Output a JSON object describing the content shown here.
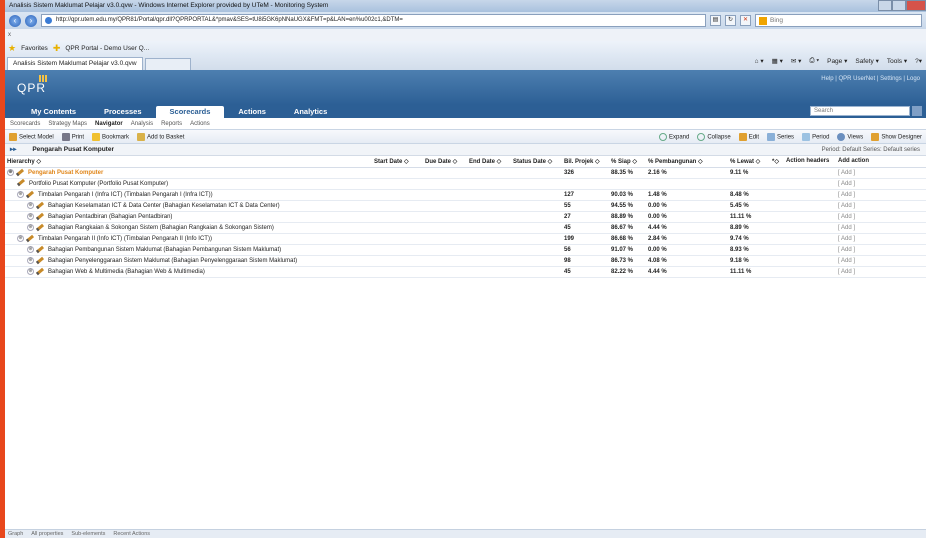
{
  "browser": {
    "title": "Analisis Sistem Maklumat Pelajar v3.0.qvw - Windows Internet Explorer provided by UTeM - Monitoring System",
    "url": "http://qpr.utem.edu.my/QPR81/Portal/qpr.dll?QPRPORTAL&*pmav&SES=tU8i5GK6pNNaUGX&FMT=p&LAN=en%u002c1,&DTM=",
    "search_placeholder": "Bing",
    "row2_text": "x",
    "favorites_label": "Favorites",
    "fav_link": "QPR Portal - Demo User Q...",
    "tab_title": "Analisis Sistem Maklumat Pelajar v3.0.qvw",
    "commands": [
      "Page ▾",
      "Safety ▾",
      "Tools ▾"
    ]
  },
  "app": {
    "logo": "QPR",
    "header_links": "Help | QPR UserNet | Settings | Logo",
    "nav_tabs": [
      "My Contents",
      "Processes",
      "Scorecards",
      "Actions",
      "Analytics"
    ],
    "active_tab": "Scorecards",
    "search_placeholder": "Search",
    "subnav": [
      "Scorecards",
      "Strategy Maps",
      "Navigator",
      "Analysis",
      "Reports",
      "Actions"
    ],
    "active_subnav": "Navigator",
    "toolbar_left": [
      "Select Model",
      "Print",
      "Bookmark",
      "Add to Basket"
    ],
    "toolbar_right": [
      "Expand",
      "Collapse",
      "Edit",
      "Series",
      "Period",
      "Views",
      "Show Designer"
    ],
    "breadcrumb": "Pengarah Pusat Komputer",
    "period_text": "Period: Default  Series: Default series"
  },
  "table": {
    "headers": [
      "Hierarchy ◇",
      "Start Date ◇",
      "Due Date ◇",
      "End Date ◇",
      "Status Date ◇",
      "Bil. Projek ◇",
      "% Siap ◇",
      "% Pembangunan ◇",
      "% Lewat ◇",
      "*◇",
      "Action headers",
      "Add action"
    ],
    "rows": [
      {
        "name": "Pengarah Pusat Komputer",
        "bil": "326",
        "siap": "88.35 %",
        "pemb": "2.16 %",
        "lewat": "9.11 %",
        "add": "[ Add ]"
      },
      {
        "name": "Portfolio Pusat Komputer (Portfolio Pusat Komputer)",
        "bil": "",
        "siap": "",
        "pemb": "",
        "lewat": "",
        "add": "[ Add ]"
      },
      {
        "name": "Timbalan Pengarah I (Infra ICT) (Timbalan Pengarah I (Infra ICT))",
        "bil": "127",
        "siap": "90.03 %",
        "pemb": "1.48 %",
        "lewat": "8.48 %",
        "add": "[ Add ]"
      },
      {
        "name": "Bahagian Keselamatan ICT & Data Center (Bahagian Keselamatan ICT & Data Center)",
        "bil": "55",
        "siap": "94.55 %",
        "pemb": "0.00 %",
        "lewat": "5.45 %",
        "add": "[ Add ]"
      },
      {
        "name": "Bahagian Pentadbiran (Bahagian Pentadbiran)",
        "bil": "27",
        "siap": "88.89 %",
        "pemb": "0.00 %",
        "lewat": "11.11 %",
        "add": "[ Add ]"
      },
      {
        "name": "Bahagian Rangkaian & Sokongan Sistem (Bahagian Rangkaian & Sokongan Sistem)",
        "bil": "45",
        "siap": "86.67 %",
        "pemb": "4.44 %",
        "lewat": "8.89 %",
        "add": "[ Add ]"
      },
      {
        "name": "Timbalan Pengarah II (Info ICT) (Timbalan Pengarah II (Info ICT))",
        "bil": "199",
        "siap": "86.68 %",
        "pemb": "2.84 %",
        "lewat": "9.74 %",
        "add": "[ Add ]"
      },
      {
        "name": "Bahagian Pembangunan Sistem Maklumat (Bahagian Pembangunan Sistem Maklumat)",
        "bil": "56",
        "siap": "91.07 %",
        "pemb": "0.00 %",
        "lewat": "8.93 %",
        "add": "[ Add ]"
      },
      {
        "name": "Bahagian Penyelenggaraan Sistem Maklumat (Bahagian Penyelenggaraan Sistem Maklumat)",
        "bil": "98",
        "siap": "86.73 %",
        "pemb": "4.08 %",
        "lewat": "9.18 %",
        "add": "[ Add ]"
      },
      {
        "name": "Bahagian Web & Multimedia (Bahagian Web & Multimedia)",
        "bil": "45",
        "siap": "82.22 %",
        "pemb": "4.44 %",
        "lewat": "11.11 %",
        "add": "[ Add ]"
      }
    ]
  },
  "statusbar": [
    "Graph",
    "All properties",
    "Sub-elements",
    "Recent Actions"
  ]
}
